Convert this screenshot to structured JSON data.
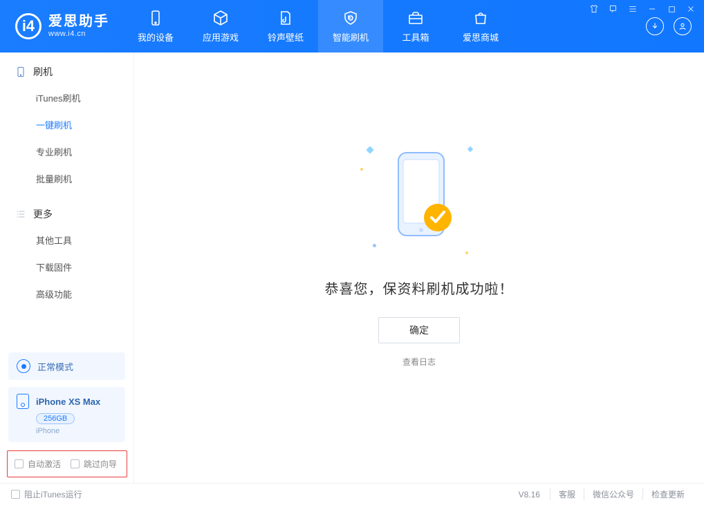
{
  "brand": {
    "title": "爱思助手",
    "subtitle": "www.i4.cn"
  },
  "nav": {
    "items": [
      {
        "label": "我的设备"
      },
      {
        "label": "应用游戏"
      },
      {
        "label": "铃声壁纸"
      },
      {
        "label": "智能刷机"
      },
      {
        "label": "工具箱"
      },
      {
        "label": "爱思商城"
      }
    ],
    "active_index": 3
  },
  "sidebar": {
    "groups": [
      {
        "heading": "刷机",
        "items": [
          {
            "label": "iTunes刷机"
          },
          {
            "label": "一键刷机"
          },
          {
            "label": "专业刷机"
          },
          {
            "label": "批量刷机"
          }
        ],
        "active_index": 1
      },
      {
        "heading": "更多",
        "items": [
          {
            "label": "其他工具"
          },
          {
            "label": "下载固件"
          },
          {
            "label": "高级功能"
          }
        ],
        "active_index": -1
      }
    ],
    "mode_label": "正常模式",
    "device": {
      "name": "iPhone XS Max",
      "capacity": "256GB",
      "subtype": "iPhone"
    },
    "checks": {
      "auto_activate": "自动激活",
      "skip_wizard": "跳过向导"
    }
  },
  "main": {
    "success_text": "恭喜您，保资料刷机成功啦！",
    "ok_label": "确定",
    "view_log": "查看日志"
  },
  "footer": {
    "block_itunes": "阻止iTunes运行",
    "version": "V8.16",
    "links": [
      "客服",
      "微信公众号",
      "检查更新"
    ]
  },
  "colors": {
    "accent": "#1a7cff",
    "success": "#ffb400"
  }
}
